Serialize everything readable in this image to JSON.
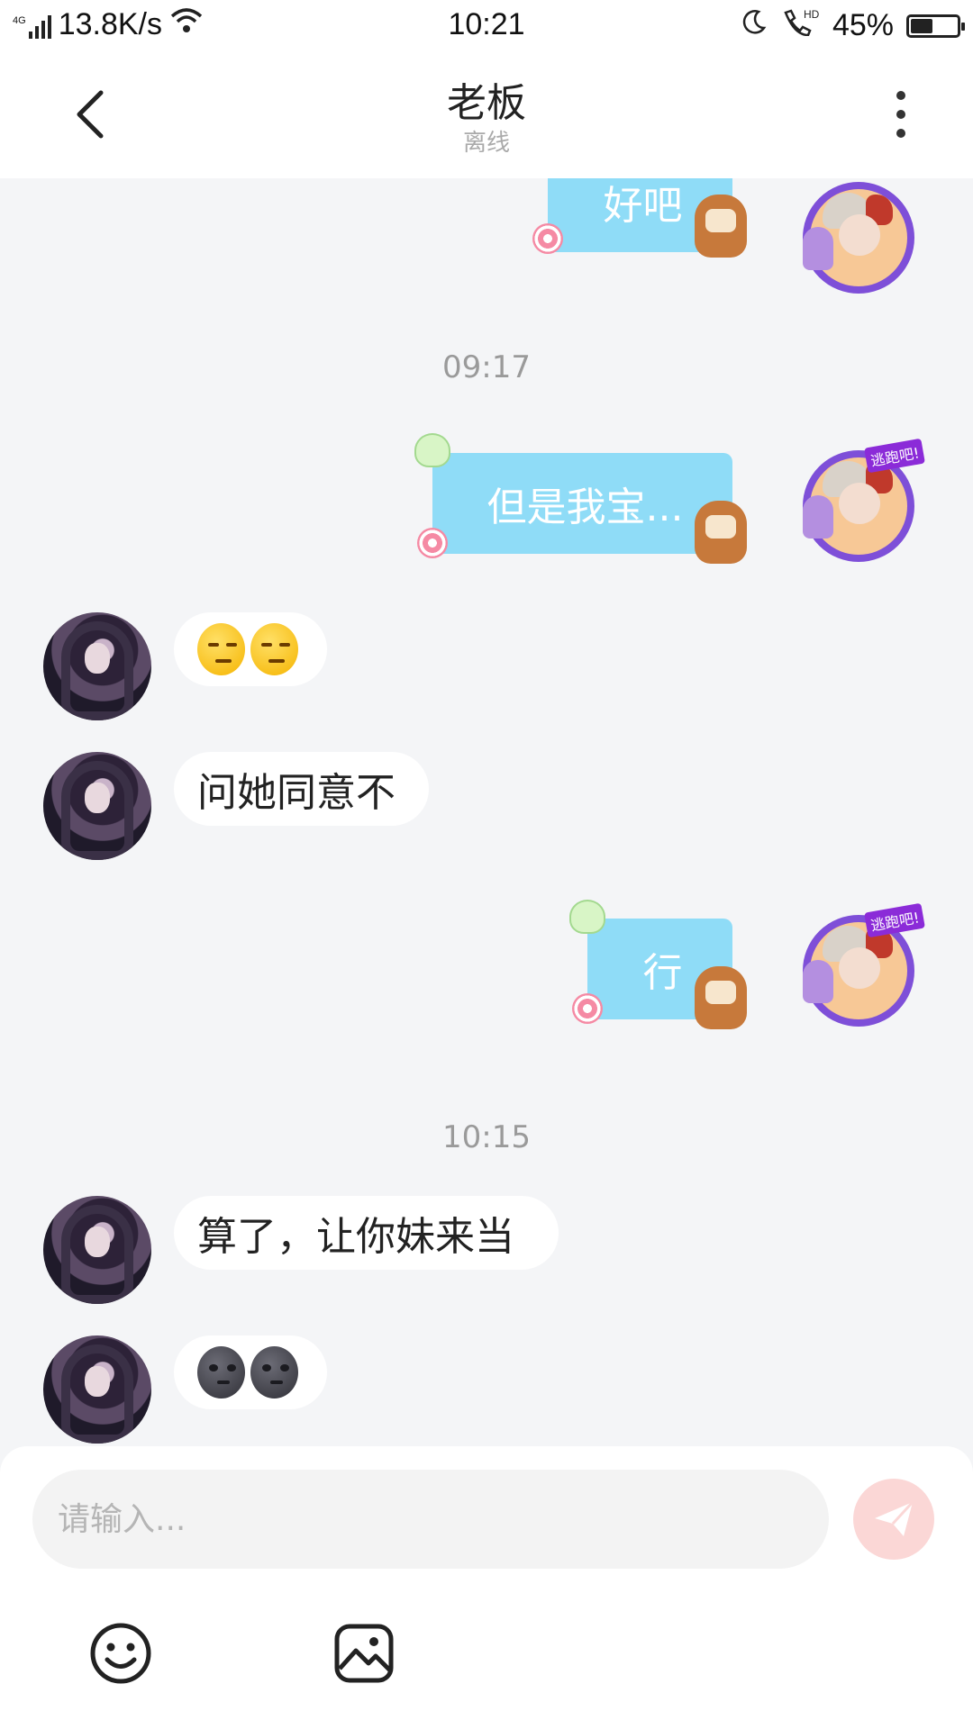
{
  "status_bar": {
    "network": "4G",
    "speed": "13.8K/s",
    "time": "10:21",
    "battery": "45%",
    "battery_level": 0.45
  },
  "header": {
    "title": "老板",
    "status": "离线"
  },
  "messages": {
    "m1": {
      "text": "好吧"
    },
    "t1": "09:17",
    "m2": {
      "text": "但是我宝..."
    },
    "m4": {
      "text": "问她同意不"
    },
    "m5": {
      "text": "行"
    },
    "t2": "10:15",
    "m6": {
      "text": "算了，让你妹来当"
    }
  },
  "input": {
    "placeholder": "请输入..."
  },
  "icons": {
    "back": "chevron-left-icon",
    "more": "more-vertical-icon",
    "send": "send-icon",
    "emoji": "smiley-icon",
    "image": "image-icon"
  },
  "colors": {
    "bubble_out": "#8fdcf7",
    "send_button": "#fbd7d6",
    "chat_background": "#f4f5f7"
  }
}
